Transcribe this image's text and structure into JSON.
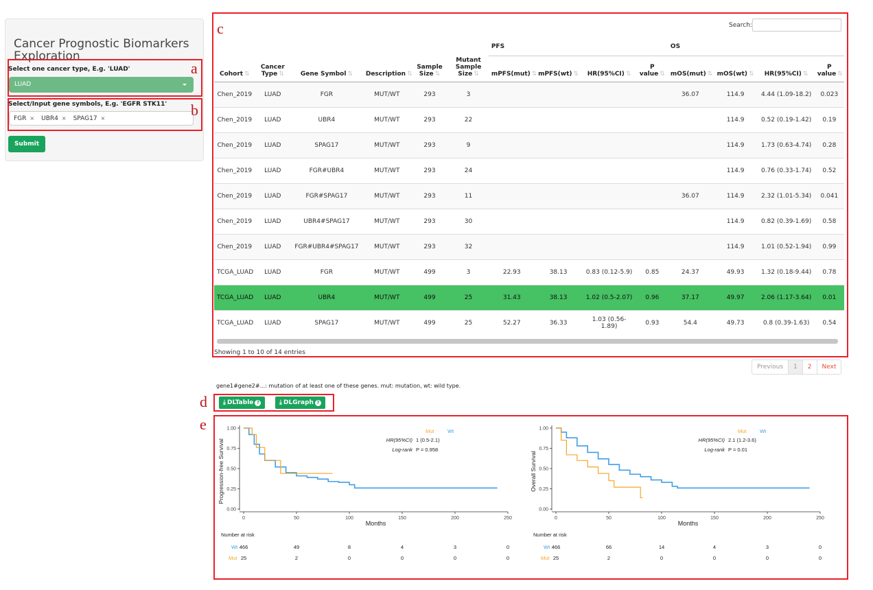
{
  "sidebar": {
    "title": "Cancer Prognostic Biomarkers Exploration",
    "cancer_label": "Select one cancer type, E.g. 'LUAD'",
    "cancer_value": "LUAD",
    "gene_label": "Select/Input gene symbols, E.g. 'EGFR STK11'",
    "gene_tags": [
      "FGR",
      "UBR4",
      "SPAG17"
    ],
    "tag_remove": "×",
    "submit_label": "Submit"
  },
  "annotations": {
    "a": "a",
    "b": "b",
    "c": "c",
    "d": "d",
    "e": "e"
  },
  "search": {
    "label": "Search:"
  },
  "table": {
    "group_pfs": "PFS",
    "group_os": "OS",
    "columns": [
      "Cohort",
      "Cancer Type",
      "Gene Symbol",
      "Description",
      "Sample Size",
      "Mutant Sample Size",
      "mPFS(mut)",
      "mPFS(wt)",
      "HR(95%CI)",
      "P value",
      "mOS(mut)",
      "mOS(wt)",
      "HR(95%CI)",
      "P value"
    ],
    "rows": [
      [
        "Chen_2019",
        "LUAD",
        "FGR",
        "MUT/WT",
        "293",
        "3",
        "",
        "",
        "",
        "",
        "36.07",
        "114.9",
        "4.44 (1.09-18.2)",
        "0.023"
      ],
      [
        "Chen_2019",
        "LUAD",
        "UBR4",
        "MUT/WT",
        "293",
        "22",
        "",
        "",
        "",
        "",
        "",
        "114.9",
        "0.52 (0.19-1.42)",
        "0.19"
      ],
      [
        "Chen_2019",
        "LUAD",
        "SPAG17",
        "MUT/WT",
        "293",
        "9",
        "",
        "",
        "",
        "",
        "",
        "114.9",
        "1.73 (0.63-4.74)",
        "0.28"
      ],
      [
        "Chen_2019",
        "LUAD",
        "FGR#UBR4",
        "MUT/WT",
        "293",
        "24",
        "",
        "",
        "",
        "",
        "",
        "114.9",
        "0.76 (0.33-1.74)",
        "0.52"
      ],
      [
        "Chen_2019",
        "LUAD",
        "FGR#SPAG17",
        "MUT/WT",
        "293",
        "11",
        "",
        "",
        "",
        "",
        "36.07",
        "114.9",
        "2.32 (1.01-5.34)",
        "0.041"
      ],
      [
        "Chen_2019",
        "LUAD",
        "UBR4#SPAG17",
        "MUT/WT",
        "293",
        "30",
        "",
        "",
        "",
        "",
        "",
        "114.9",
        "0.82 (0.39-1.69)",
        "0.58"
      ],
      [
        "Chen_2019",
        "LUAD",
        "FGR#UBR4#SPAG17",
        "MUT/WT",
        "293",
        "32",
        "",
        "",
        "",
        "",
        "",
        "114.9",
        "1.01 (0.52-1.94)",
        "0.99"
      ],
      [
        "TCGA_LUAD",
        "LUAD",
        "FGR",
        "MUT/WT",
        "499",
        "3",
        "22.93",
        "38.13",
        "0.83 (0.12-5.9)",
        "0.85",
        "24.37",
        "49.93",
        "1.32 (0.18-9.44)",
        "0.78"
      ],
      [
        "TCGA_LUAD",
        "LUAD",
        "UBR4",
        "MUT/WT",
        "499",
        "25",
        "31.43",
        "38.13",
        "1.02 (0.5-2.07)",
        "0.96",
        "37.17",
        "49.97",
        "2.06 (1.17-3.64)",
        "0.01"
      ],
      [
        "TCGA_LUAD",
        "LUAD",
        "SPAG17",
        "MUT/WT",
        "499",
        "25",
        "52.27",
        "36.33",
        "1.03 (0.56-1.89)",
        "0.93",
        "54.4",
        "49.73",
        "0.8 (0.39-1.63)",
        "0.54"
      ]
    ],
    "selected_row": 8,
    "info": "Showing 1 to 10 of 14 entries"
  },
  "pager": {
    "previous": "Previous",
    "pages": [
      "1",
      "2"
    ],
    "next": "Next"
  },
  "note": "gene1#gene2#...: mutation of at least one of these genes. mut: mutation, wt: wild type.",
  "downloads": {
    "table_label": "DLTable",
    "graph_label": "DLGraph",
    "help": "?"
  },
  "colors": {
    "mut": "#f5a623",
    "wt": "#3f9ee8",
    "accent": "#1aa35c",
    "highlight": "#46c163",
    "annotation": "#e8202a"
  },
  "km_common": {
    "xlabel": "Months",
    "xticks": [
      "0",
      "50",
      "100",
      "150",
      "200",
      "250"
    ],
    "yticks": [
      "0.00",
      "0.25",
      "0.50",
      "0.75",
      "1.00"
    ],
    "legend_mut": "Mut",
    "legend_wt": "Wt",
    "hr_label": "HR(95%CI)",
    "logrank_label": "Log-rank",
    "risk_title": "Number at risk"
  },
  "chart_data": [
    {
      "type": "line",
      "ylabel": "Progression-free Survival",
      "xlabel": "Months",
      "xlim": [
        0,
        250
      ],
      "ylim": [
        0,
        1
      ],
      "hr_value": "1 (0.5-2.1)",
      "p_value": "P = 0.958",
      "series": [
        {
          "name": "Wt",
          "points": [
            [
              0,
              1.0
            ],
            [
              5,
              0.92
            ],
            [
              10,
              0.8
            ],
            [
              15,
              0.68
            ],
            [
              20,
              0.6
            ],
            [
              30,
              0.52
            ],
            [
              40,
              0.45
            ],
            [
              50,
              0.41
            ],
            [
              60,
              0.39
            ],
            [
              70,
              0.37
            ],
            [
              80,
              0.34
            ],
            [
              90,
              0.33
            ],
            [
              100,
              0.3
            ],
            [
              105,
              0.26
            ],
            [
              150,
              0.26
            ],
            [
              200,
              0.26
            ],
            [
              240,
              0.26
            ]
          ]
        },
        {
          "name": "Mut",
          "points": [
            [
              0,
              1.0
            ],
            [
              8,
              0.92
            ],
            [
              12,
              0.76
            ],
            [
              20,
              0.6
            ],
            [
              30,
              0.6
            ],
            [
              35,
              0.44
            ],
            [
              50,
              0.44
            ],
            [
              84,
              0.44
            ]
          ]
        }
      ],
      "risk": {
        "Wt": [
          "466",
          "49",
          "8",
          "4",
          "3",
          "0"
        ],
        "Mut": [
          "25",
          "2",
          "0",
          "0",
          "0",
          "0"
        ]
      }
    },
    {
      "type": "line",
      "ylabel": "Overall Survival",
      "xlabel": "Months",
      "xlim": [
        0,
        250
      ],
      "ylim": [
        0,
        1
      ],
      "hr_value": "2.1 (1.2-3.6)",
      "p_value": "P = 0.01",
      "series": [
        {
          "name": "Wt",
          "points": [
            [
              0,
              1.0
            ],
            [
              5,
              0.95
            ],
            [
              10,
              0.88
            ],
            [
              20,
              0.78
            ],
            [
              30,
              0.7
            ],
            [
              40,
              0.62
            ],
            [
              50,
              0.55
            ],
            [
              60,
              0.48
            ],
            [
              70,
              0.43
            ],
            [
              80,
              0.4
            ],
            [
              90,
              0.36
            ],
            [
              100,
              0.33
            ],
            [
              110,
              0.28
            ],
            [
              115,
              0.26
            ],
            [
              150,
              0.26
            ],
            [
              200,
              0.26
            ],
            [
              240,
              0.26
            ]
          ]
        },
        {
          "name": "Mut",
          "points": [
            [
              0,
              1.0
            ],
            [
              5,
              0.85
            ],
            [
              10,
              0.67
            ],
            [
              20,
              0.6
            ],
            [
              30,
              0.52
            ],
            [
              40,
              0.44
            ],
            [
              50,
              0.35
            ],
            [
              55,
              0.27
            ],
            [
              75,
              0.27
            ],
            [
              80,
              0.14
            ],
            [
              82,
              0.14
            ]
          ]
        }
      ],
      "risk": {
        "Wt": [
          "466",
          "66",
          "14",
          "4",
          "3",
          "0"
        ],
        "Mut": [
          "25",
          "2",
          "0",
          "0",
          "0",
          "0"
        ]
      }
    }
  ]
}
